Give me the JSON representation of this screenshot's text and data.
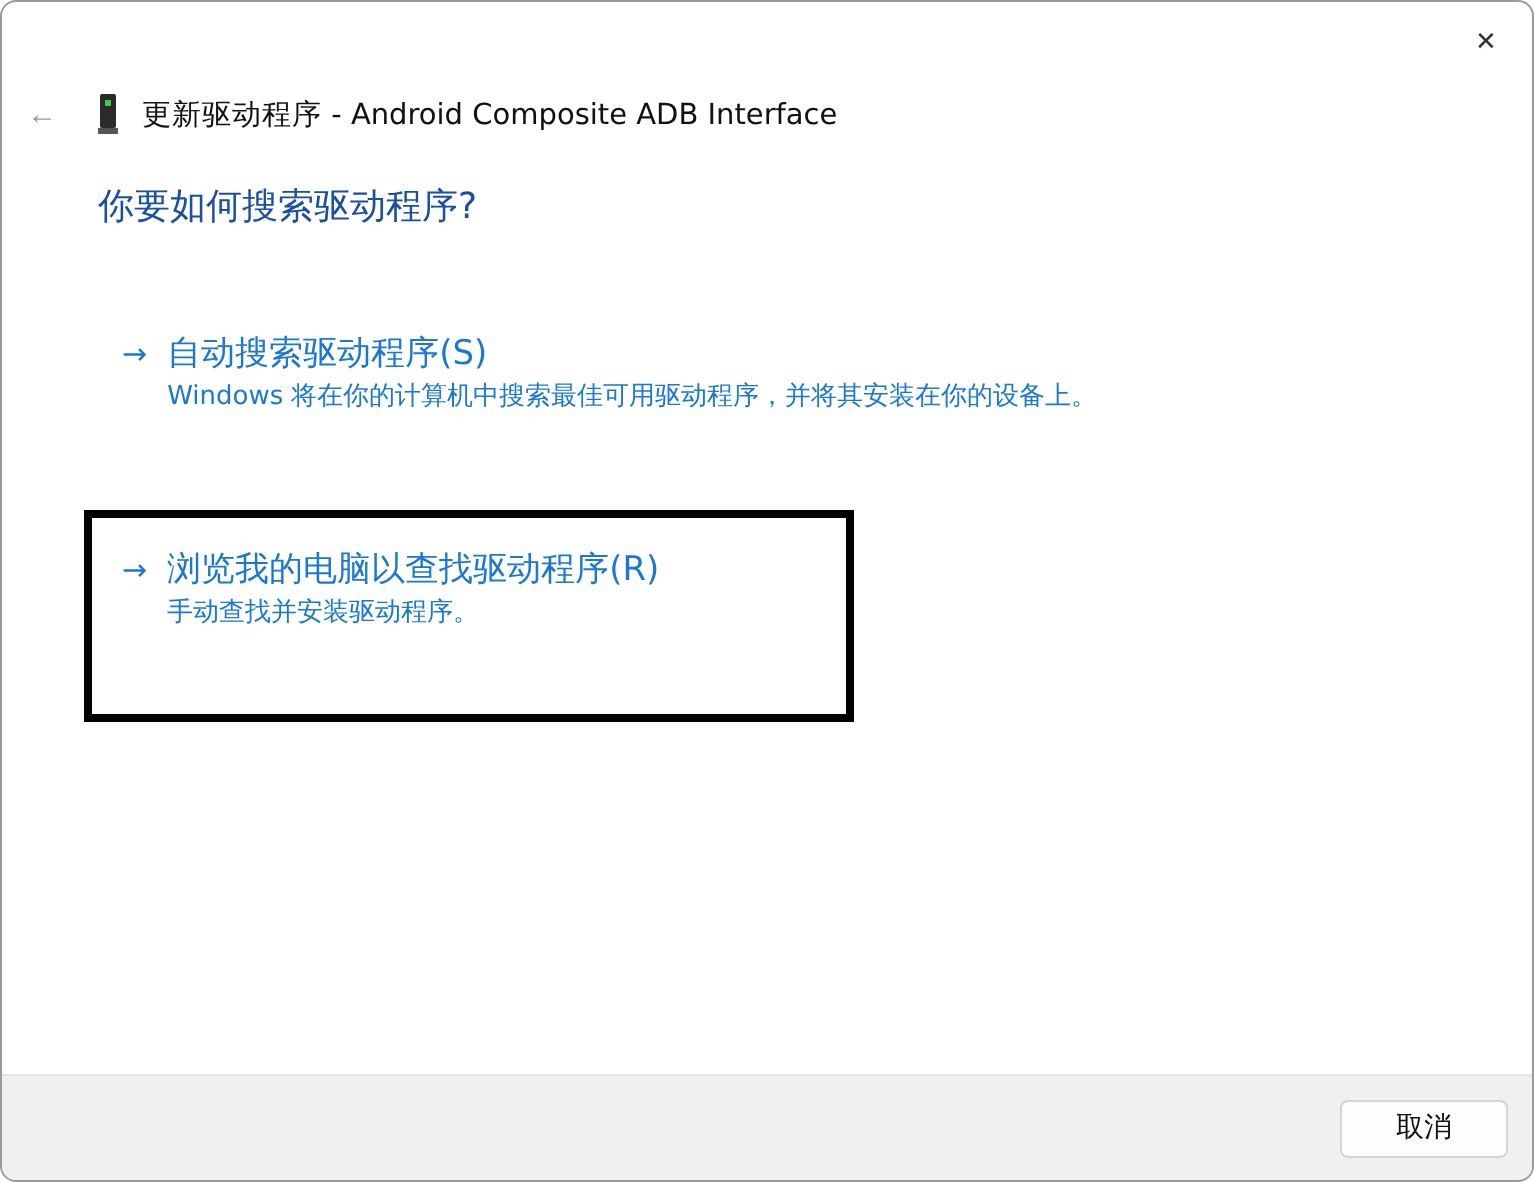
{
  "window": {
    "close_glyph": "✕",
    "back_glyph": "←",
    "title": "更新驱动程序 - Android Composite ADB Interface"
  },
  "heading": "你要如何搜索驱动程序?",
  "options": [
    {
      "arrow": "→",
      "title": "自动搜索驱动程序(S)",
      "description": "Windows 将在你的计算机中搜索最佳可用驱动程序，并将其安装在你的设备上。",
      "highlighted": false
    },
    {
      "arrow": "→",
      "title": "浏览我的电脑以查找驱动程序(R)",
      "description": "手动查找并安装驱动程序。",
      "highlighted": true
    }
  ],
  "buttons": [
    "取消"
  ]
}
